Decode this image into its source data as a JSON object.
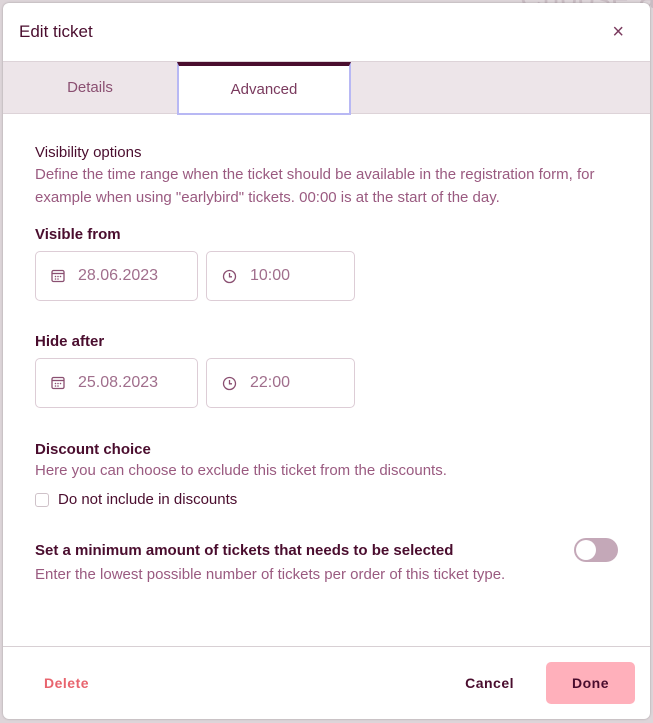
{
  "background": {
    "partial_text": "Choose a"
  },
  "dialog": {
    "title": "Edit ticket",
    "close_label": "×",
    "tabs": [
      {
        "label": "Details",
        "active": false
      },
      {
        "label": "Advanced",
        "active": true
      }
    ]
  },
  "visibility": {
    "heading": "Visibility options",
    "description": "Define the time range when the ticket should be available in the registration form, for example when using \"earlybird\" tickets. 00:00 is at the start of the day.",
    "visible_from": {
      "label": "Visible from",
      "date": "28.06.2023",
      "time": "10:00",
      "date_icon": "calendar-icon",
      "time_icon": "clock-icon"
    },
    "hide_after": {
      "label": "Hide after",
      "date": "25.08.2023",
      "time": "22:00",
      "date_icon": "calendar-icon",
      "time_icon": "clock-icon"
    }
  },
  "discount": {
    "heading": "Discount choice",
    "description": "Here you can choose to exclude this ticket from the discounts.",
    "checkbox_label": "Do not include in discounts",
    "checked": false
  },
  "minimum": {
    "heading": "Set a minimum amount of tickets that needs to be selected",
    "description": "Enter the lowest possible number of tickets per order of this ticket type.",
    "enabled": false
  },
  "footer": {
    "delete_label": "Delete",
    "cancel_label": "Cancel",
    "done_label": "Done"
  },
  "colors": {
    "primary_text": "#4a0d2e",
    "muted_text": "#9a5a80",
    "delete": "#e8646e",
    "done_button": "#ffb0bb",
    "tab_active_border": "#4a0d2e",
    "focus_ring": "#b8b8f4"
  }
}
